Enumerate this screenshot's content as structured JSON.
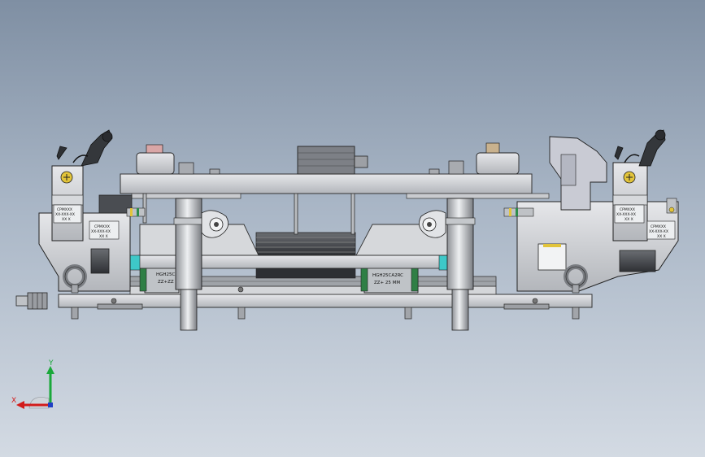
{
  "viewport": {
    "background_top": "#7f8fa3",
    "background_bottom": "#d3dae3"
  },
  "labels": {
    "left_plate": [
      "CPMXXX",
      "XX-XXX-XX",
      "XX X"
    ],
    "left_plate_2": [
      "CPMXXX",
      "XX-XXX-XX",
      "XX X"
    ],
    "right_plate": [
      "CPMXXX",
      "XX-XXX-XX",
      "XX X"
    ],
    "right_plate_2": [
      "CPMXXX",
      "XX-XXX-XX",
      "XX X"
    ],
    "left_rail": [
      "HGH25CA",
      "ZZ+ZZ"
    ],
    "right_rail": [
      "HGH25CA2RC",
      "ZZ+ 25 MM"
    ]
  },
  "triad": {
    "x_label": "X",
    "y_label": "Y"
  },
  "colors": {
    "x_axis": "#d21b1b",
    "y_axis": "#1aa83a",
    "z_axis": "#1f3fc4",
    "cyan_accent": "#3ec8c8",
    "yellow_accent": "#e2c43a",
    "body_gray": "#c8cace",
    "dark_gray": "#4a4d52"
  }
}
